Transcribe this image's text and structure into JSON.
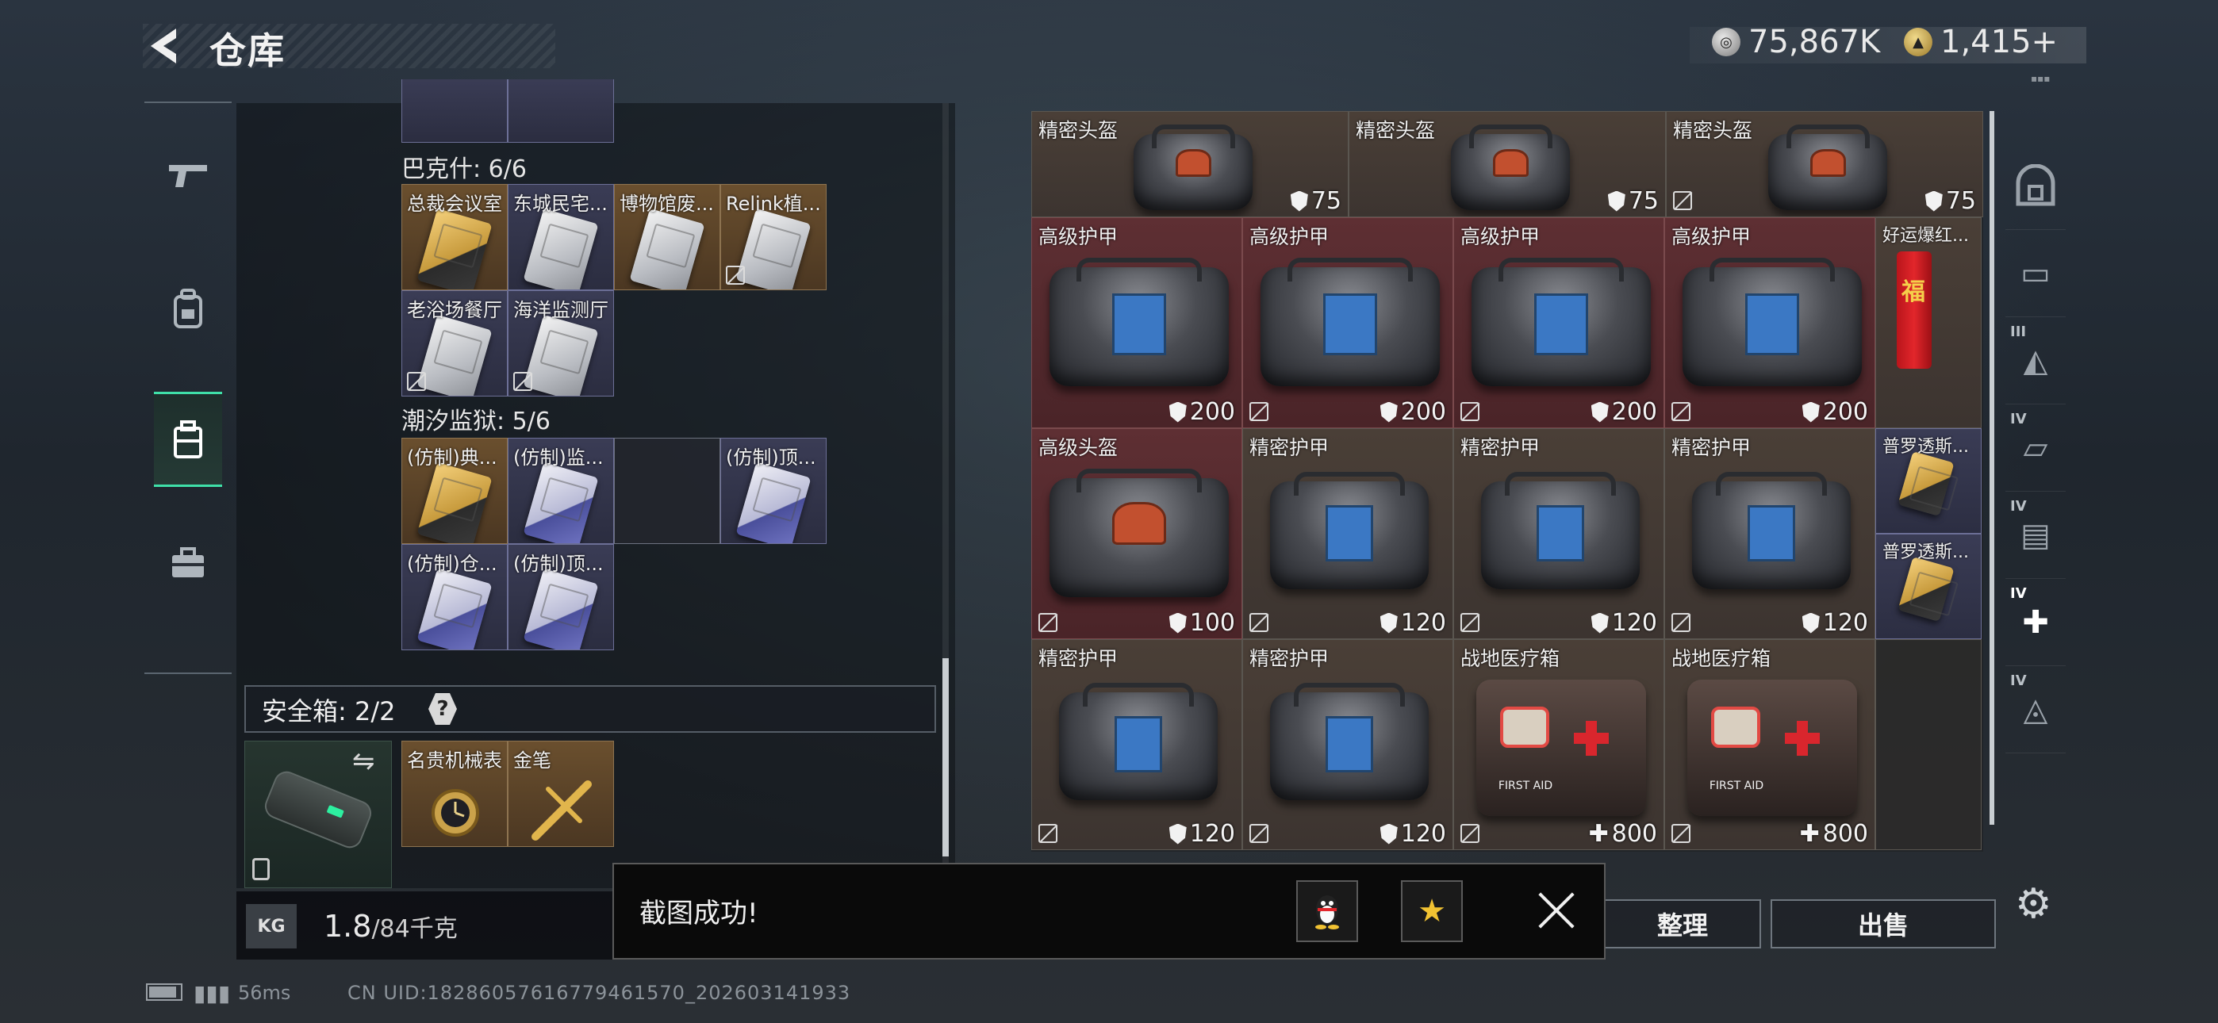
{
  "header": {
    "title": "仓库",
    "currency_silver": "75,867K",
    "currency_gold": "1,415+"
  },
  "left_rail": [
    "pistol-icon",
    "backpack-icon",
    "stash-box-icon",
    "toolbox-icon"
  ],
  "keycards": {
    "group1_title": "巴克什: 6/6",
    "group1": [
      "总裁会议室",
      "东城民宅...",
      "博物馆废...",
      "Relink植...",
      "老浴场餐厅",
      "海洋监测厅"
    ],
    "group2_title": "潮汐监狱: 5/6",
    "group2": [
      "(仿制)典...",
      "(仿制)监...",
      "(仿制)顶...",
      "(仿制)仓...",
      "(仿制)顶..."
    ]
  },
  "safe_box": {
    "title": "安全箱: 2/2",
    "help": "?",
    "items": [
      "名贵机械表",
      "金笔"
    ]
  },
  "weight": {
    "badge": "KG",
    "current": "1.8",
    "max": "/84千克"
  },
  "stash": {
    "row1": [
      {
        "label": "精密头盔",
        "value": "75"
      },
      {
        "label": "精密头盔",
        "value": "75"
      },
      {
        "label": "精密头盔",
        "value": "75"
      }
    ],
    "row2": [
      {
        "label": "高级护甲",
        "value": "200"
      },
      {
        "label": "高级护甲",
        "value": "200"
      },
      {
        "label": "高级护甲",
        "value": "200"
      },
      {
        "label": "高级护甲",
        "value": "200"
      },
      {
        "label": "好运爆红...",
        "value": ""
      }
    ],
    "row3": [
      {
        "label": "高级头盔",
        "value": "100"
      },
      {
        "label": "精密护甲",
        "value": "120"
      },
      {
        "label": "精密护甲",
        "value": "120"
      },
      {
        "label": "精密护甲",
        "value": "120"
      }
    ],
    "side_small": [
      {
        "label": "普罗透斯..."
      },
      {
        "label": "普罗透斯..."
      }
    ],
    "row4": [
      {
        "label": "精密护甲",
        "value": "120"
      },
      {
        "label": "精密护甲",
        "value": "120"
      },
      {
        "label": "战地医疗箱",
        "value": "800"
      },
      {
        "label": "战地医疗箱",
        "value": "800"
      }
    ],
    "firecracker_char": "福",
    "medkit_text": "FIRST AID"
  },
  "right_rail": {
    "tiers": [
      "",
      "",
      "III",
      "IV",
      "IV",
      "IV",
      "IV"
    ]
  },
  "actions": {
    "sort": "整理",
    "sell": "出售"
  },
  "toast": {
    "text": "截图成功!"
  },
  "footer": {
    "ping": "56ms",
    "uid": "CN UID:18286057616779461570_202603141933"
  }
}
